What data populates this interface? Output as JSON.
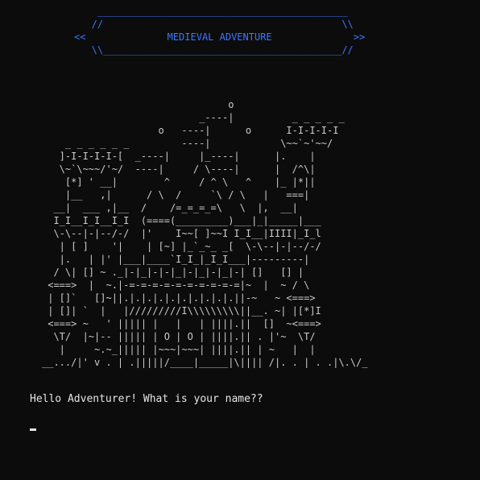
{
  "banner": {
    "title": "MEDIEVAL ADVENTURE",
    "art": "    ___________________________________________\n   //                                         \\\\\n<<              MEDIEVAL ADVENTURE              >>\n   \\\\_________________________________________//",
    "color": "#3b78ff"
  },
  "castle_art": "                                o\n                           _----|          _ _ _ _ _\n                    o   ----|      o      I-I-I-I-I\n    _ _ _ _ _ _         ----|            \\~~`~'~~/\n   ]-I-I-I-I-[  _----|     |_----|      |.    |\n   \\~`\\~~~/'~/  ----|     / \\----|      |  /^\\|\n    [*] ' __|        ^     / ^ \\   ^    |_ |*||\n    |__   ,|      / \\  /     `\\ / \\   |   ===|\n  __|  ___ ,|__  /    /=_=_=_=\\   \\  |,  __|\n  I_I__I_I__I_I  (====(_________)___|_|_____|___\n  \\-\\--|-|--/-/  |'    I~~[ ]~~I I_I__|IIII|_I_l\n   | [ ]    '|    | [~] |_`_~_ _[  \\-\\--|-|--/-/\n   |.   | |' |___|____`I_I_|_I_I___|---------|\n  / \\| [] ~ ._|-|_|-|-|_|-|_|-|_|-| []   [] |\n <===>  |  ~.|-=-=-=-=-=-=-=-=-=-=|~  |  ~ / \\\n | []`   []~||.|.|.|.|.|.|.|.|.|.||-~   ~ <===>\n | []| `  |   |/////////I\\\\\\\\\\\\\\\\\\||__. ~| |[*]I\n <===> ~   ' ||||| |   |   | ||||.||  []  ~<===>\n  \\T/  |~|-- ||||| | O | O | ||||.|| . |'~  \\T/\n   |     ~.~_||||| |~~~|~~~| ||||.|| | ~   |  |\n__.../|' v . | .|||||/____|_____|\\|||| /|. . | . .|\\.\\/_",
  "prompt": {
    "text": "Hello Adventurer! What is your name??",
    "input_value": ""
  },
  "colors": {
    "background": "#0c0c0c",
    "art": "#cccccc",
    "banner": "#3b78ff",
    "prompt": "#e6e6e6"
  }
}
